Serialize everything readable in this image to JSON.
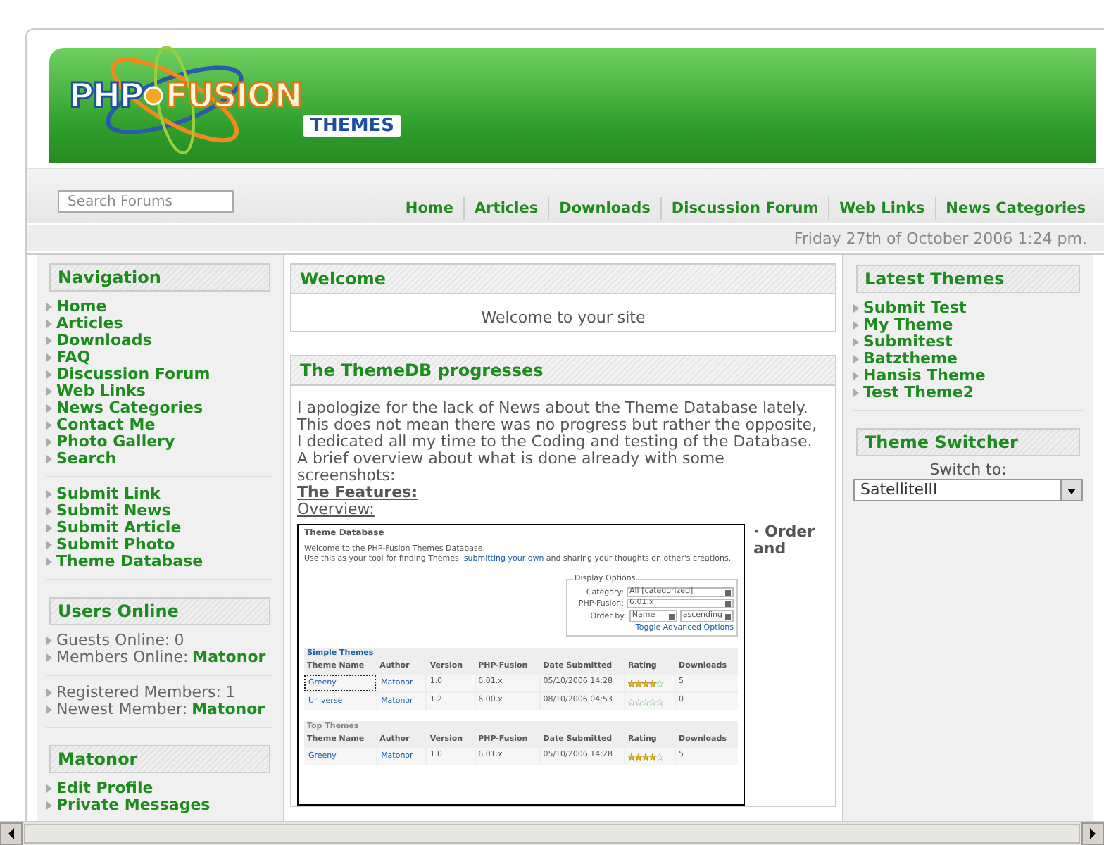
{
  "header": {
    "logo": {
      "word1": "PHP",
      "word2": "FUSION",
      "word3": "THEMES"
    }
  },
  "navbar": {
    "search": {
      "placeholder": "Search Forums"
    },
    "links": [
      "Home",
      "Articles",
      "Downloads",
      "Discussion Forum",
      "Web Links",
      "News Categories"
    ]
  },
  "date": "Friday 27th of October 2006 1:24 pm.",
  "left": [
    {
      "title": "Navigation",
      "groups": [
        [
          {
            "kind": "link",
            "label": "Home"
          },
          {
            "kind": "link",
            "label": "Articles"
          },
          {
            "kind": "link",
            "label": "Downloads"
          },
          {
            "kind": "link",
            "label": "FAQ"
          },
          {
            "kind": "link",
            "label": "Discussion Forum"
          },
          {
            "kind": "link",
            "label": "Web Links"
          },
          {
            "kind": "link",
            "label": "News Categories"
          },
          {
            "kind": "link",
            "label": "Contact Me"
          },
          {
            "kind": "link",
            "label": "Photo Gallery"
          },
          {
            "kind": "link",
            "label": "Search"
          }
        ],
        [
          {
            "kind": "link",
            "label": "Submit Link"
          },
          {
            "kind": "link",
            "label": "Submit News"
          },
          {
            "kind": "link",
            "label": "Submit Article"
          },
          {
            "kind": "link",
            "label": "Submit Photo"
          },
          {
            "kind": "link",
            "label": "Theme Database"
          }
        ]
      ]
    },
    {
      "title": "Users Online",
      "groups": [
        [
          {
            "kind": "stat",
            "label": "Guests Online:",
            "value": "0"
          },
          {
            "kind": "user",
            "label": "Members Online:",
            "value": "Matonor"
          }
        ],
        [
          {
            "kind": "stat",
            "label": "Registered Members:",
            "value": "1"
          },
          {
            "kind": "user",
            "label": "Newest Member:",
            "value": "Matonor"
          }
        ]
      ]
    },
    {
      "title": "Matonor",
      "groups": [
        [
          {
            "kind": "link",
            "label": "Edit Profile"
          },
          {
            "kind": "link",
            "label": "Private Messages"
          }
        ]
      ]
    }
  ],
  "center": {
    "welcome": {
      "title": "Welcome",
      "body": "Welcome to your site"
    },
    "article": {
      "title": "The ThemeDB progresses",
      "paragraphs": [
        "I apologize for the lack of News about the Theme Database lately. This does not mean there was no progress but rather the opposite, I dedicated all my time to the Coding and testing of the Database.",
        "A brief overview about what is done already with some screenshots:"
      ],
      "features": "The Features:",
      "overview": "Overview:",
      "side_text": "· Order and",
      "screenshot": {
        "title": "Theme Database",
        "intro_line": "Welcome to the PHP-Fusion Themes Database.",
        "intro_before": "Use this as your tool for finding Themes, ",
        "intro_link": "submitting your own",
        "intro_after": " and sharing your thoughts on other's creations.",
        "options": {
          "legend": "Display Options",
          "fields": [
            {
              "label": "Category:",
              "value": "All [categorized]"
            },
            {
              "label": "PHP-Fusion:",
              "value": "6.01.x"
            }
          ],
          "order_label": "Order by:",
          "order_value": "Name",
          "direction": "ascending",
          "toggle": "Toggle Advanced Options"
        },
        "tables": [
          {
            "title": "Simple Themes",
            "columns": [
              "Theme Name",
              "Author",
              "Version",
              "PHP-Fusion",
              "Date Submitted",
              "Rating",
              "Downloads"
            ],
            "rows": [
              {
                "name": "Greeny",
                "focused": true,
                "author": "Matonor",
                "version": "1.0",
                "php": "6.01.x",
                "date": "05/10/2006 14:28",
                "stars": 4,
                "downloads": "5"
              },
              {
                "name": "Universe",
                "focused": false,
                "author": "Matonor",
                "version": "1.2",
                "php": "6.00.x",
                "date": "08/10/2006 04:53",
                "stars": 0,
                "downloads": "0"
              }
            ]
          },
          {
            "title": "Top Themes",
            "columns": [
              "Theme Name",
              "Author",
              "Version",
              "PHP-Fusion",
              "Date Submitted",
              "Rating",
              "Downloads"
            ],
            "rows": [
              {
                "name": "Greeny",
                "focused": false,
                "author": "Matonor",
                "version": "1.0",
                "php": "6.01.x",
                "date": "05/10/2006 14:28",
                "stars": 4,
                "downloads": "5"
              }
            ]
          }
        ]
      }
    }
  },
  "right": {
    "latest": {
      "title": "Latest Themes",
      "items": [
        "Submit Test",
        "My Theme",
        "Submitest",
        "Batztheme",
        "Hansis Theme",
        "Test Theme2"
      ]
    },
    "switcher": {
      "title": "Theme Switcher",
      "label": "Switch to:",
      "value": "SatelliteIII"
    }
  }
}
